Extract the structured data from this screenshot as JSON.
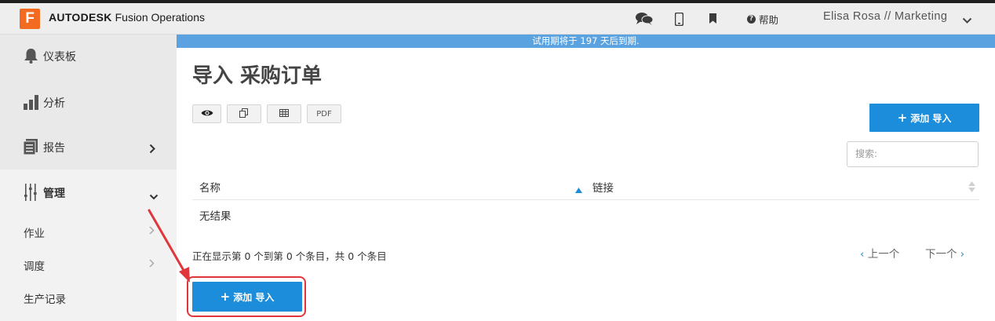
{
  "topbar": {
    "logo_letter": "F",
    "brand_bold": "AUTODESK",
    "brand_rest": " Fusion Operations",
    "help_label": "帮助",
    "user": "Elisa Rosa // Marketing",
    "icons": [
      "chat-icon",
      "mobile-icon",
      "bookmark-icon",
      "help-icon",
      "chevron-down-icon"
    ]
  },
  "banner": {
    "text": "试用期将于 197 天后到期."
  },
  "sidebar": {
    "items": [
      {
        "label": "仪表板",
        "icon": "bell-icon"
      },
      {
        "label": "分析",
        "icon": "bar-chart-icon"
      },
      {
        "label": "报告",
        "icon": "report-icon"
      },
      {
        "label": "管理",
        "icon": "sliders-icon"
      }
    ],
    "subitems": [
      {
        "label": "作业"
      },
      {
        "label": "调度"
      },
      {
        "label": "生产记录"
      }
    ]
  },
  "page": {
    "title": "导入 采购订单"
  },
  "toolbar": {
    "pdf_label": "PDF"
  },
  "add_import": {
    "plus": "+",
    "label": "添加 导入"
  },
  "search": {
    "placeholder": "搜索:"
  },
  "table": {
    "columns": [
      "名称",
      "链接"
    ],
    "empty_text": "无结果",
    "info": "正在显示第 0 个到第 0 个条目，共 0 个条目"
  },
  "pager": {
    "prev": "上一个",
    "next": "下一个"
  },
  "colors": {
    "accent": "#1c8ddb",
    "logo": "#f26b20",
    "banner": "#5ba3e0",
    "highlight": "#e0363b"
  }
}
